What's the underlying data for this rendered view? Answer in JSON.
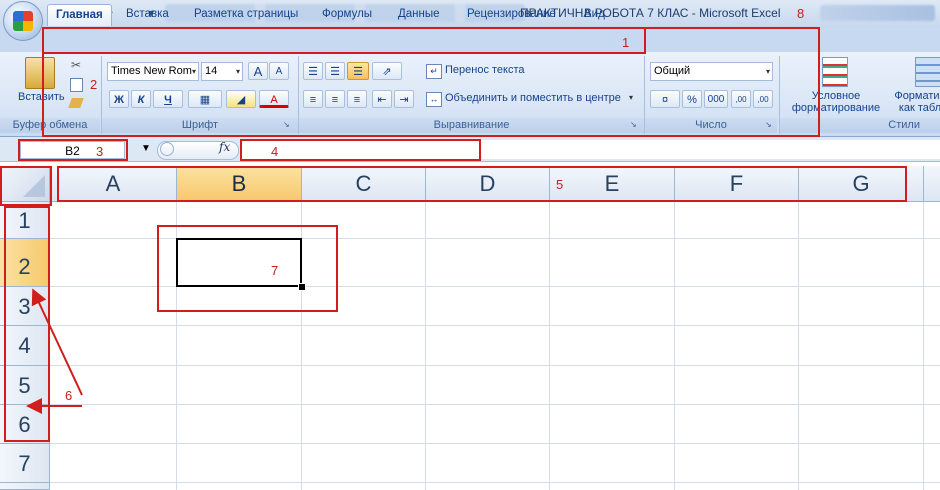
{
  "window": {
    "title": "ПРАКТИЧНА РОБОТА 7 КЛАС - Microsoft Excel"
  },
  "tabs": [
    "Главная",
    "Вставка",
    "Разметка страницы",
    "Формулы",
    "Данные",
    "Рецензирование",
    "Вид"
  ],
  "ribbon": {
    "clipboard": {
      "paste_label": "Вставить",
      "group_label": "Буфер обмена"
    },
    "font": {
      "font_name": "Times New Rom",
      "font_size": "14",
      "bold": "Ж",
      "italic": "К",
      "underline": "Ч",
      "grow": "A",
      "shrink": "A",
      "font_color_letter": "A",
      "group_label": "Шрифт"
    },
    "alignment": {
      "wrap_text": "Перенос текста",
      "merge_center": "Объединить и поместить в центре",
      "group_label": "Выравнивание"
    },
    "number": {
      "format": "Общий",
      "percent": "%",
      "thousands": "000",
      "inc_decimal": ",00",
      "dec_decimal": ",00",
      "group_label": "Число"
    },
    "styles": {
      "conditional_formatting": "Условное форматирование",
      "format_as_table": "Форматир как табл",
      "group_label": "Стили"
    }
  },
  "formula_bar": {
    "name_box": "B2",
    "fx": "fx"
  },
  "columns": [
    "A",
    "B",
    "C",
    "D",
    "E",
    "F",
    "G"
  ],
  "rows": [
    "1",
    "2",
    "3",
    "4",
    "5",
    "6",
    "7"
  ],
  "selected_cell": "B2",
  "annotations": {
    "labels": [
      "1",
      "2",
      "3",
      "4",
      "5",
      "6",
      "7",
      "8"
    ],
    "color": "#d21d1d"
  }
}
